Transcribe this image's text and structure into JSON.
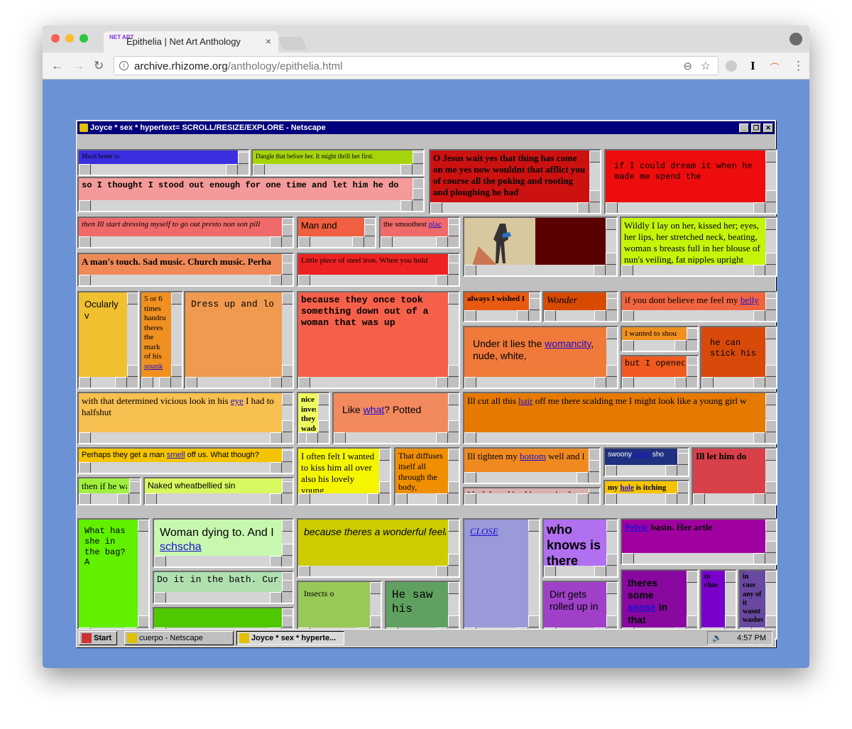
{
  "browser": {
    "tab_logo": "NET ART",
    "tab_title": "Epithelia | Net Art Anthology",
    "tab_close": "×",
    "url_domain": "archive.rhizome.org",
    "url_path": "/anthology/epithelia.html"
  },
  "window": {
    "title": "Joyce * sex * hypertext= SCROLL/RESIZE/EXPLORE - Netscape",
    "min": "_",
    "restore": "❐",
    "close": "✕"
  },
  "taskbar": {
    "start": "Start",
    "task1": "cuerpo - Netscape",
    "task2": "Joyce * sex * hyperte...",
    "clock": "4:57 PM"
  },
  "frames": [
    {
      "text": "Much better to"
    },
    {
      "text": "Dangle that before her. It might thrill her first."
    },
    {
      "text": "so I thought I stood out enough for one time and let him he do"
    },
    {
      "text": "O Jesus wait yes that thing has come on me yes now wouldnt that afflict you of course all the poking and rooting and ploughing he had"
    },
    {
      "text": "if I could dream it when he made me spend the"
    },
    {
      "text": "then Ill start dressing myself to go out presto non son pill"
    },
    {
      "text": "Man and"
    },
    {
      "text": "the smoothest",
      "link": "plac"
    },
    {
      "text": "Wildly I lay on her, kissed her; eyes, her lips, her stretched neck, beating, woman s breasts full in her blouse of nun's veiling, fat nipples upright"
    },
    {
      "text": "A man's touch. Sad music. Church music. Perha"
    },
    {
      "text": "Little piece of steel iron. When you hold"
    },
    {
      "text": "Ocularly v"
    },
    {
      "text": "5 or 6 times handru theres the mark of his",
      "link": "spunk"
    },
    {
      "text": "Dress up and lo"
    },
    {
      "text": "because they once took something down out of a woman that was up"
    },
    {
      "text": "always I wished I"
    },
    {
      "text": "Wonder"
    },
    {
      "text": "if you dont believe me feel my",
      "link": "belly"
    },
    {
      "text": "Under it lies the",
      "link": "womancity",
      "after": ", nude, white,"
    },
    {
      "text": "I wanted to shou"
    },
    {
      "text": "he can stick his"
    },
    {
      "text": "but I opened"
    },
    {
      "text": "with that determined vicious look in his",
      "link": "eye",
      "after": " I had to halfshut"
    },
    {
      "text": "nice inven they wade"
    },
    {
      "text": "Like",
      "link": "what",
      "after": "? Potted"
    },
    {
      "text": "Ill cut all this",
      "link": "hair",
      "after": " off me there scalding me I might look like a young girl w"
    },
    {
      "text": "Perhaps they get a man",
      "link": "smell",
      "after": " off us. What though?"
    },
    {
      "text": "I often felt I wanted to kiss him all over also his lovely young"
    },
    {
      "text": "That diffuses itself all through the body,"
    },
    {
      "text": "Ill tighten my",
      "link": "bottom",
      "after": " well and l"
    },
    {
      "text": "swoony",
      "link": "lovey",
      "after": " sho"
    },
    {
      "text": "Ill let him do"
    },
    {
      "text": "then if he wants to kiss my",
      "link": "bottom",
      "after": " Ill"
    },
    {
      "text": "Naked wheatbellied sin"
    },
    {
      "text": "my",
      "link": "hole",
      "after": " is itching me always whe"
    },
    {
      "text": "I had that white thing coming from me and Floey made me"
    },
    {
      "text": "What has she in the bag? A"
    },
    {
      "text": "Woman dying to. And I",
      "link": "schscha"
    },
    {
      "text": "because theres a wonderful feeling there all the time so tender how did we",
      "link": "finish",
      "after": " it off yes O"
    },
    {
      "text": "",
      "link": "CLOSE"
    },
    {
      "text": "who knows is there anything the"
    },
    {
      "link": "Pelvic",
      "after": " basin. Her artle"
    },
    {
      "text": "Do it in the bath. Curious longing I"
    },
    {
      "text": "Insects o"
    },
    {
      "text": "He saw his"
    },
    {
      "text": "Dirt gets rolled up in"
    },
    {
      "text": "theres some",
      "link": "sense",
      "after": " in that"
    },
    {
      "text": "to chas"
    },
    {
      "text": "in case any of it wasnt washed"
    }
  ],
  "colors": {
    "window_bg": "#6a92d4",
    "titlebar": "#00007c",
    "link": "#1a0dd6"
  }
}
